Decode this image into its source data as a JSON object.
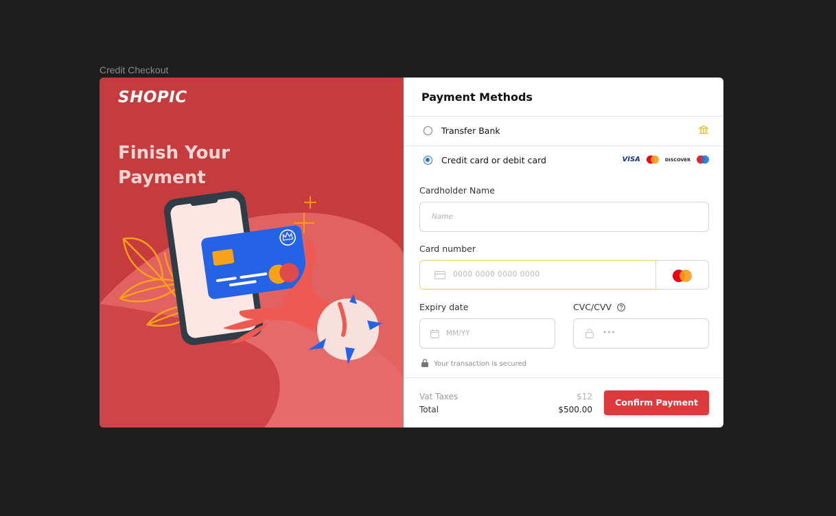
{
  "frame_label": "Credit Checkout",
  "left": {
    "brand": "SHOPIC",
    "headline_line1": "Finish Your",
    "headline_line2": "Payment"
  },
  "payment": {
    "title": "Payment Methods",
    "methods": [
      {
        "label": "Transfer Bank",
        "selected": false,
        "icon": "bank-icon"
      },
      {
        "label": "Credit card or debit card",
        "selected": true,
        "icons": [
          "visa-logo",
          "mastercard-logo",
          "discover-logo",
          "maestro-logo"
        ]
      }
    ],
    "brand_visa": "VISA",
    "brand_discover": "DISCOVER"
  },
  "form": {
    "cardholder_label": "Cardholder Name",
    "cardholder_placeholder": "Name",
    "cardnumber_label": "Card number",
    "cardnumber_placeholder": "0000  0000  0000  0000",
    "expiry_label": "Expiry date",
    "expiry_placeholder": "MM/YY",
    "cvc_label": "CVC/CVV",
    "cvc_placeholder": "•••",
    "secure_text": "Your transaction is secured"
  },
  "summary": {
    "vat_label": "Vat Taxes",
    "vat_value": "$12",
    "total_label": "Total",
    "total_value": "$500.00",
    "confirm_label": "Confirm Payment"
  },
  "colors": {
    "background": "#1e1e1e",
    "left_panel": "#c63b3e",
    "accent_red": "#dc3a3c",
    "radio_blue": "#1f6fe8",
    "card_blue": "#2563e6",
    "focus_yellow": "#f2d25a"
  }
}
